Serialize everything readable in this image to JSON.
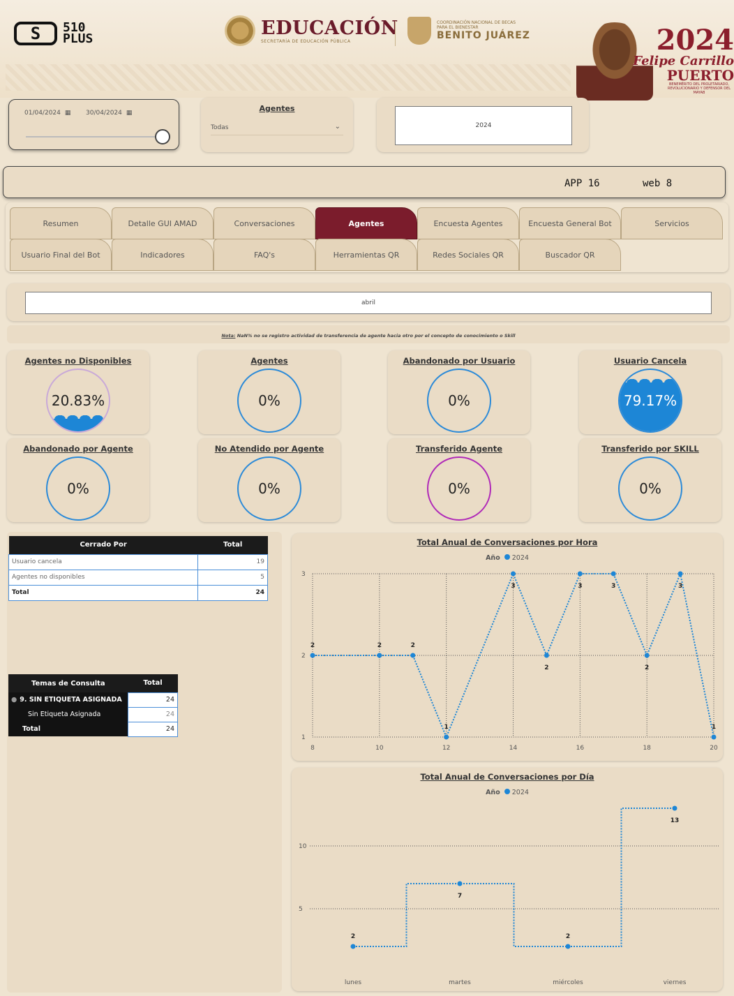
{
  "header": {
    "brand_510": "510",
    "brand_plus": "PLUS",
    "edu_title": "EDUCACIÓN",
    "edu_sub": "SECRETARÍA DE EDUCACIÓN PÚBLICA",
    "bj_line1": "COORDINACIÓN NACIONAL DE BECAS PARA EL BIENESTAR",
    "bj_line2": "BENITO JUÁREZ",
    "year_title": "2024",
    "year_name1": "Felipe Carrillo",
    "year_name2": "PUERTO",
    "year_small": "BENEMÉRITO DEL PROLETARIADO, REVOLUCIONARIO Y DEFENSOR DEL MAYAB"
  },
  "filters": {
    "date_start": "01/04/2024",
    "date_end": "30/04/2024",
    "agentes_label": "Agentes",
    "agentes_value": "Todas",
    "year_value": "2024",
    "month_value": "abril"
  },
  "channels": {
    "app": "APP 16",
    "web": "web 8"
  },
  "tabs_row1": [
    "Resumen",
    "Detalle GUI AMAD",
    "Conversaciones",
    "Agentes",
    "Encuesta Agentes",
    "Encuesta General Bot",
    "Servicios"
  ],
  "tabs_row2": [
    "Usuario Final del Bot",
    "Indicadores",
    "FAQ's",
    "Herramientas QR",
    "Redes Sociales QR",
    "Buscador QR"
  ],
  "active_tab": "Agentes",
  "note": {
    "prefix": "Nota:",
    "text": " NaN% no se registro actividad de transferencia de agente hacia otro por el concepto de conocimiento o Skill"
  },
  "kpis": [
    {
      "title": "Agentes no Disponibles",
      "value": "20.83%",
      "fraction": 0.2083,
      "ring": "#c9a9d8"
    },
    {
      "title": "Agentes",
      "value": "0%",
      "fraction": 0,
      "ring": "#2b8ad8"
    },
    {
      "title": "Abandonado por Usuario",
      "value": "0%",
      "fraction": 0,
      "ring": "#2b8ad8"
    },
    {
      "title": "Usuario Cancela",
      "value": "79.17%",
      "fraction": 0.7917,
      "ring": "#2b8ad8"
    },
    {
      "title": "Abandonado por Agente",
      "value": "0%",
      "fraction": 0,
      "ring": "#2b8ad8"
    },
    {
      "title": "No Atendido por Agente",
      "value": "0%",
      "fraction": 0,
      "ring": "#2b8ad8"
    },
    {
      "title": "Transferido Agente",
      "value": "0%",
      "fraction": 0,
      "ring": "#b02ab8"
    },
    {
      "title": "Transferido por SKILL",
      "value": "0%",
      "fraction": 0,
      "ring": "#2b8ad8"
    }
  ],
  "cerrado_table": {
    "headers": [
      "Cerrado Por",
      "Total"
    ],
    "rows": [
      [
        "Usuario cancela",
        "19"
      ],
      [
        "Agentes no disponibles",
        "5"
      ]
    ],
    "total": [
      "Total",
      "24"
    ]
  },
  "temas_table": {
    "headers": [
      "Temas de Consulta",
      "Total"
    ],
    "rows": [
      [
        "9. SIN ETIQUETA ASIGNADA",
        "24"
      ],
      [
        "Sin Etiqueta Asignada",
        "24"
      ]
    ],
    "total": [
      "Total",
      "24"
    ]
  },
  "chart_data": [
    {
      "type": "line",
      "title": "Total Anual de Conversaciones por Hora",
      "legend_title": "Año",
      "series": [
        {
          "name": "2024",
          "x": [
            8,
            10,
            11,
            12,
            14,
            15,
            16,
            17,
            18,
            19,
            20
          ],
          "values": [
            2,
            2,
            2,
            1,
            3,
            2,
            3,
            3,
            2,
            3,
            1
          ]
        }
      ],
      "xticks": [
        8,
        10,
        12,
        14,
        16,
        18,
        20
      ],
      "yticks": [
        1,
        2,
        3
      ],
      "xlim": [
        8,
        20
      ],
      "ylim": [
        1,
        3
      ],
      "grid": true,
      "color": "#1d86d6"
    },
    {
      "type": "line",
      "title": "Total Anual de Conversaciones por Día",
      "legend_title": "Año",
      "series": [
        {
          "name": "2024",
          "values": [
            2,
            7,
            2,
            13
          ]
        }
      ],
      "categories": [
        "lunes",
        "martes",
        "miércoles",
        "viernes"
      ],
      "yticks": [
        5,
        10
      ],
      "ylim": [
        0,
        14
      ],
      "step": true,
      "grid": true,
      "color": "#1d86d6"
    }
  ]
}
